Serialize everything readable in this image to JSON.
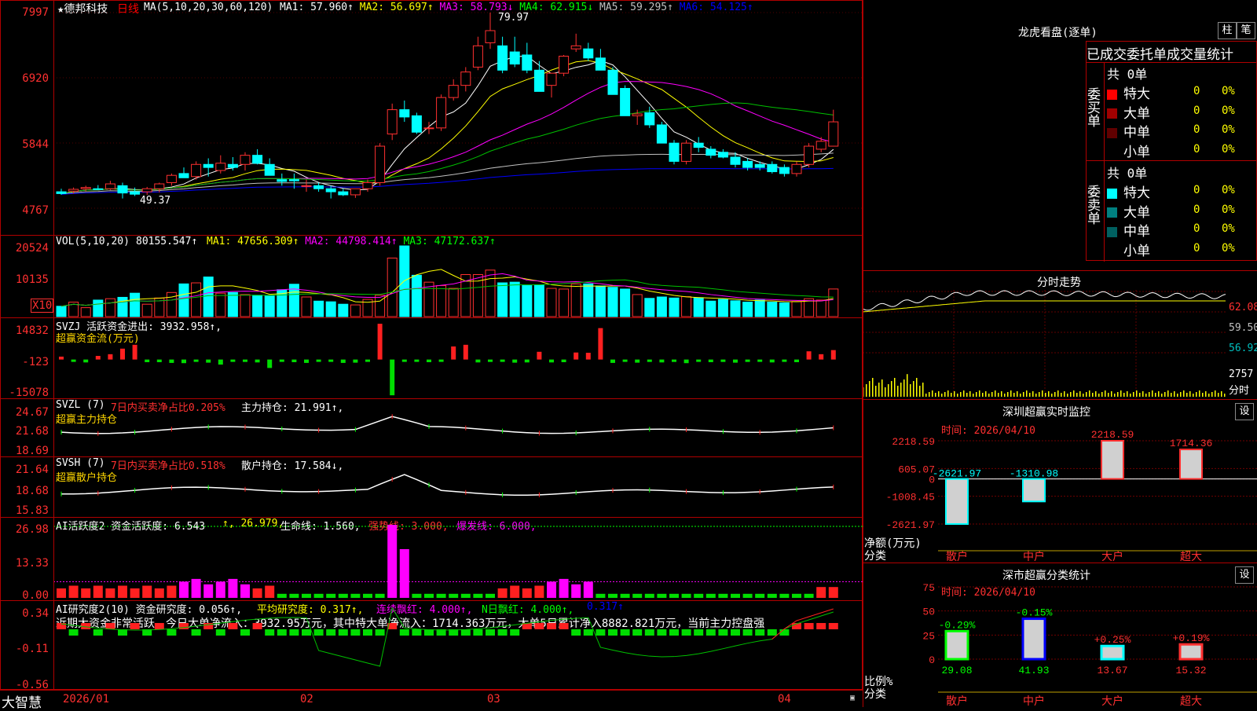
{
  "main": {
    "stock_name": "★德邦科技",
    "period": "日线",
    "ma_params": "MA(5,10,20,30,60,120)",
    "ma_values": [
      {
        "label": "MA1: 57.960↑",
        "color": "#ffffff"
      },
      {
        "label": "MA2: 56.697↑",
        "color": "#ffff00"
      },
      {
        "label": "MA3: 58.793↓",
        "color": "#ff00ff"
      },
      {
        "label": "MA4: 62.915↓",
        "color": "#00ff00"
      },
      {
        "label": "MA5: 59.295↑",
        "color": "#c0c0c0"
      },
      {
        "label": "MA6: 54.125↑",
        "color": "#0000ff"
      }
    ],
    "y_ticks": [
      "7997",
      "6920",
      "5844",
      "4767"
    ],
    "high_label": "79.97",
    "low_label": "49.37"
  },
  "volume": {
    "title": "VOL(5,10,20)",
    "value": "80155.547↑",
    "ma": [
      {
        "label": "MA1: 47656.309↑",
        "color": "#ffff00"
      },
      {
        "label": "MA2: 44798.414↑",
        "color": "#ff00ff"
      },
      {
        "label": "MA3: 47172.637↑",
        "color": "#00ff00"
      }
    ],
    "y_ticks": [
      "20524",
      "10135"
    ],
    "unit": "X10"
  },
  "svzj": {
    "title": "SVZJ  活跃资金进出: 3932.958↑,",
    "subtitle": "超赢资金流(万元)",
    "y_ticks": [
      "14832",
      "-123",
      "-15078"
    ]
  },
  "svzl": {
    "title_a": "SVZL (7)",
    "title_b": "7日内买卖净占比0.205%",
    "title_c": "主力持仓: 21.991↑,",
    "subtitle": "超赢主力持仓",
    "y_ticks": [
      "24.67",
      "21.68",
      "18.69"
    ]
  },
  "svsh": {
    "title_a": "SVSH (7)",
    "title_b": "7日内买卖净占比0.518%",
    "title_c": "散户持仓: 17.584↓,",
    "subtitle": "超赢散户持仓",
    "y_ticks": [
      "21.64",
      "18.68",
      "15.83"
    ]
  },
  "ai_active": {
    "title": "AI活跃度2 资金活跃度: 6.543",
    "t2": "↑, 26.979,",
    "t3": "生命线: 1.560,",
    "t4": "强势线: 3.000,",
    "t5": "爆发线: 6.000,",
    "y_ticks": [
      "26.98",
      "13.33",
      "0.00"
    ]
  },
  "ai_research": {
    "title": "AI研究度2(10) 资金研究度: 0.056↑,",
    "t2": "平均研究度: 0.317↑,",
    "t3": "连续飘红: 4.000↑,",
    "t4": "N日飘红: 4.000↑,",
    "t5": "0.317↑",
    "note": "近期大资金非常活跃，今日大单净流入：3932.95万元，其中特大单净流入：1714.363万元，大单5日累计净入8882.821万元，当前主力控盘强",
    "y_ticks": [
      "0.34",
      "-0.11",
      "-0.56"
    ]
  },
  "x_axis": {
    "labels": [
      "2026/01",
      "02",
      "03",
      "04"
    ]
  },
  "footer": {
    "brand": "大智慧"
  },
  "right": {
    "dragon_title": "龙虎看盘(逐单)",
    "btn_bar": "柱",
    "btn_pen": "笔",
    "stats_title": "已成交委托单成交量统计",
    "buy_label": "委买单",
    "sell_label": "委卖单",
    "buy_total": "共 0单",
    "sell_total": "共 0单",
    "buy_rows": [
      {
        "name": "特大",
        "val": "0",
        "pct": "0%",
        "color": "#ff0000"
      },
      {
        "name": "大单",
        "val": "0",
        "pct": "0%",
        "color": "#a00000"
      },
      {
        "name": "中单",
        "val": "0",
        "pct": "0%",
        "color": "#600000"
      },
      {
        "name": "小单",
        "val": "0",
        "pct": "0%",
        "color": ""
      }
    ],
    "sell_rows": [
      {
        "name": "特大",
        "val": "0",
        "pct": "0%",
        "color": "#00ffff"
      },
      {
        "name": "大单",
        "val": "0",
        "pct": "0%",
        "color": "#008080"
      },
      {
        "name": "中单",
        "val": "0",
        "pct": "0%",
        "color": "#006060"
      },
      {
        "name": "小单",
        "val": "0",
        "pct": "0%",
        "color": ""
      }
    ],
    "intraday_title": "分时走势",
    "intraday_ticks": [
      "62.08",
      "59.50",
      "56.92",
      "2757",
      "分时"
    ],
    "monitor_title": "深圳超赢实时监控",
    "monitor_time": "时间: 2026/04/10",
    "monitor_ticks": [
      "2218.59",
      "605.07",
      "0",
      "-1008.45",
      "-2621.97"
    ],
    "monitor_ylabel": "净额(万元)",
    "monitor_xlabel": "分类",
    "set_label": "设",
    "class_title": "深市超赢分类统计",
    "class_time": "时间: 2026/04/10",
    "class_ticks": [
      "75",
      "50",
      "25",
      "0"
    ],
    "class_ylabel": "比例%",
    "class_xlabel": "分类"
  },
  "chart_data": [
    {
      "type": "bar",
      "title": "深圳超赢实时监控",
      "ylabel": "净额(万元)",
      "categories": [
        "散户",
        "中户",
        "大户",
        "超大"
      ],
      "values": [
        -2621.97,
        -1310.98,
        2218.59,
        1714.36
      ],
      "ylim": [
        -2621.97,
        2218.59
      ]
    },
    {
      "type": "bar",
      "title": "深市超赢分类统计",
      "ylabel": "比例%",
      "categories": [
        "散户",
        "中户",
        "大户",
        "超大"
      ],
      "values": [
        29.08,
        41.93,
        13.67,
        15.32
      ],
      "changes": [
        "-0.29%",
        "-0.15%",
        "+0.25%",
        "+0.19%"
      ],
      "ylim": [
        0,
        75
      ]
    },
    {
      "type": "candlestick",
      "title": "德邦科技 日线",
      "ylim": [
        47.67,
        79.97
      ],
      "ohlc": [
        [
          50.5,
          51.0,
          50.0,
          50.2
        ],
        [
          50.6,
          51.2,
          50.2,
          50.9
        ],
        [
          51.0,
          51.5,
          50.6,
          51.2
        ],
        [
          51.0,
          51.6,
          50.8,
          50.9
        ],
        [
          51.0,
          52.3,
          50.8,
          51.8
        ],
        [
          51.5,
          52.0,
          49.4,
          50.3
        ],
        [
          50.5,
          51.2,
          49.8,
          50.1
        ],
        [
          50.5,
          51.3,
          50.0,
          51.0
        ],
        [
          51.0,
          52.0,
          50.4,
          51.8
        ],
        [
          52.0,
          53.5,
          51.5,
          53.2
        ],
        [
          53.5,
          54.5,
          52.8,
          52.8
        ],
        [
          53.0,
          55.5,
          52.5,
          55.0
        ],
        [
          55.0,
          56.0,
          53.0,
          54.5
        ],
        [
          54.0,
          56.5,
          53.5,
          55.2
        ],
        [
          55.0,
          56.2,
          54.0,
          54.5
        ],
        [
          55.0,
          57.0,
          54.0,
          56.5
        ],
        [
          56.5,
          57.5,
          55.0,
          55.2
        ],
        [
          55.0,
          56.0,
          53.5,
          53.2
        ],
        [
          52.5,
          53.5,
          51.5,
          52.2
        ],
        [
          52.5,
          53.5,
          51.0,
          52.3
        ],
        [
          51.5,
          52.5,
          50.5,
          51.5
        ],
        [
          51.5,
          52.0,
          50.5,
          51.0
        ],
        [
          51.0,
          51.5,
          49.4,
          50.5
        ],
        [
          50.5,
          51.0,
          49.8,
          50.0
        ],
        [
          50.0,
          51.0,
          49.5,
          51.0
        ],
        [
          51.0,
          52.5,
          50.5,
          52.0
        ],
        [
          52.0,
          58.5,
          51.5,
          58.0
        ],
        [
          60.0,
          65.0,
          59.0,
          64.0
        ],
        [
          64.0,
          65.5,
          62.0,
          62.8
        ],
        [
          63.0,
          63.5,
          60.0,
          60.3
        ],
        [
          61.0,
          62.0,
          60.0,
          61.0
        ],
        [
          61.0,
          66.5,
          60.5,
          66.0
        ],
        [
          66.0,
          69.0,
          65.5,
          68.0
        ],
        [
          68.0,
          71.0,
          67.0,
          70.2
        ],
        [
          71.0,
          76.0,
          70.5,
          74.5
        ],
        [
          75.0,
          79.97,
          74.0,
          77.0
        ],
        [
          74.5,
          76.0,
          70.0,
          70.5
        ],
        [
          73.5,
          76.0,
          71.0,
          71.5
        ],
        [
          73.0,
          75.0,
          70.0,
          70.5
        ],
        [
          70.5,
          72.0,
          68.0,
          67.0
        ],
        [
          68.0,
          70.0,
          66.0,
          70.0
        ],
        [
          70.0,
          73.0,
          69.5,
          72.8
        ],
        [
          74.0,
          76.5,
          73.5,
          74.5
        ],
        [
          74.0,
          75.0,
          72.0,
          72.5
        ],
        [
          72.5,
          74.0,
          71.0,
          70.5
        ],
        [
          70.5,
          71.0,
          67.0,
          66.5
        ],
        [
          67.5,
          68.0,
          63.0,
          63.0
        ],
        [
          63.0,
          64.0,
          61.5,
          63.3
        ],
        [
          63.5,
          64.5,
          61.0,
          61.5
        ],
        [
          61.5,
          62.0,
          58.5,
          58.5
        ],
        [
          58.5,
          59.0,
          55.0,
          55.5
        ],
        [
          55.5,
          59.0,
          55.0,
          58.5
        ],
        [
          58.5,
          59.5,
          57.0,
          57.8
        ],
        [
          57.5,
          58.0,
          56.0,
          56.5
        ],
        [
          57.0,
          57.5,
          56.0,
          56.2
        ],
        [
          56.2,
          57.0,
          54.5,
          55.0
        ],
        [
          55.5,
          56.0,
          54.0,
          54.5
        ],
        [
          55.0,
          55.5,
          54.0,
          54.5
        ],
        [
          55.0,
          55.5,
          53.5,
          53.8
        ],
        [
          54.5,
          55.0,
          53.0,
          53.5
        ],
        [
          53.5,
          55.5,
          53.0,
          55.0
        ],
        [
          55.0,
          58.5,
          54.5,
          58.0
        ],
        [
          57.5,
          59.5,
          57.0,
          58.8
        ],
        [
          58.0,
          64.0,
          58.0,
          62.0
        ]
      ]
    },
    {
      "type": "bar",
      "title": "VOL(5,10,20)",
      "ylim": [
        0,
        20524
      ],
      "values": [
        3000,
        4200,
        2600,
        4800,
        5200,
        5600,
        6800,
        3600,
        5400,
        7000,
        9500,
        9800,
        11500,
        6800,
        7000,
        6400,
        6200,
        6000,
        7800,
        9400,
        5700,
        4500,
        4300,
        3600,
        3400,
        5000,
        6200,
        17000,
        20524,
        12000,
        10000,
        9000,
        8200,
        12200,
        12200,
        13500,
        9800,
        10000,
        9000,
        9200,
        8200,
        8000,
        9500,
        9500,
        8900,
        8500,
        8000,
        6400,
        5300,
        5700,
        5400,
        5800,
        5500,
        4500,
        5000,
        4600,
        4200,
        4800,
        4200,
        4000,
        4400,
        5200,
        4800,
        8015
      ]
    },
    {
      "type": "bar",
      "title": "SVZJ 活跃资金进出",
      "ylim": [
        -15078,
        14832
      ],
      "values": [
        -700,
        -900,
        -1200,
        -1000,
        -1100,
        -1400,
        -1500,
        -1100,
        -1100,
        -1400,
        -1500,
        -800,
        -1300,
        -2100,
        -900,
        -1000,
        -1200,
        -3500,
        -900,
        -1100,
        -1400,
        -800,
        -900,
        -1400,
        -1300,
        -800,
        -8000,
        -14800,
        -900,
        -700,
        -1100,
        -900,
        -800,
        -1400,
        -1200,
        -1000,
        -800,
        -1300,
        -1200,
        -1400,
        -1200,
        -1100,
        -800,
        -1000,
        -900,
        -1400,
        -900,
        -1300,
        -1000,
        -1200,
        -1000,
        -1500,
        -900,
        -1100,
        -1000,
        -1300,
        -1000,
        -900,
        -1200,
        -900,
        -1100,
        -1000,
        -1000,
        -1000
      ],
      "positive": [
        1200,
        0,
        0,
        1500,
        2200,
        4500,
        6100,
        0,
        0,
        0,
        0,
        0,
        0,
        0,
        0,
        0,
        0,
        0,
        0,
        0,
        0,
        0,
        0,
        0,
        0,
        0,
        14800,
        0,
        0,
        0,
        0,
        0,
        5400,
        6100,
        0,
        0,
        0,
        0,
        0,
        3200,
        0,
        0,
        2900,
        2800,
        13000,
        0,
        0,
        0,
        0,
        0,
        0,
        0,
        0,
        0,
        0,
        0,
        0,
        0,
        0,
        0,
        0,
        3400,
        2200,
        3900
      ]
    }
  ]
}
